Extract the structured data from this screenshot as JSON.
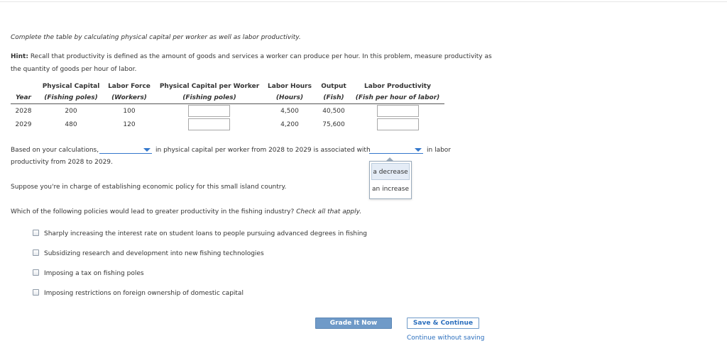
{
  "instruction": "Complete the table by calculating physical capital per worker as well as labor productivity.",
  "hint": {
    "label": "Hint:",
    "line1": "Recall that productivity is defined as the amount of goods and services a worker can produce per hour. In this problem, measure productivity as",
    "line2": "the quantity of goods per hour of labor."
  },
  "table": {
    "headers": [
      {
        "title": "",
        "sub": "Year"
      },
      {
        "title": "Physical Capital",
        "sub": "(Fishing poles)"
      },
      {
        "title": "Labor Force",
        "sub": "(Workers)"
      },
      {
        "title": "Physical Capital per Worker",
        "sub": "(Fishing poles)"
      },
      {
        "title": "Labor Hours",
        "sub": "(Hours)"
      },
      {
        "title": "Output",
        "sub": "(Fish)"
      },
      {
        "title": "Labor Productivity",
        "sub": "(Fish per hour of labor)"
      }
    ],
    "rows": [
      {
        "year": "2028",
        "capital": "200",
        "labor": "100",
        "capital_per_worker": "",
        "hours": "4,500",
        "output": "40,500",
        "productivity": ""
      },
      {
        "year": "2029",
        "capital": "480",
        "labor": "120",
        "capital_per_worker": "",
        "hours": "4,200",
        "output": "75,600",
        "productivity": ""
      }
    ]
  },
  "sentence": {
    "part1": "Based on your calculations,",
    "part2": "in physical capital per worker from 2028 to 2029 is associated with",
    "part3": "in labor",
    "part4": "productivity from 2028 to 2029.",
    "dropdown1_value": "",
    "dropdown2_value": ""
  },
  "dropdown_options": [
    "a decrease",
    "an increase"
  ],
  "scenario": "Suppose you're in charge of establishing economic policy for this small island country.",
  "question": {
    "text": "Which of the following policies would lead to greater productivity in the fishing industry?",
    "emphasis": "Check all that apply."
  },
  "options": [
    "Sharply increasing the interest rate on student loans to people pursuing advanced degrees in fishing",
    "Subsidizing research and development into new fishing technologies",
    "Imposing a tax on fishing poles",
    "Imposing restrictions on foreign ownership of domestic capital"
  ],
  "buttons": {
    "grade": "Grade It Now",
    "save": "Save & Continue",
    "continue_link": "Continue without saving"
  },
  "colors": {
    "accent": "#3377cc",
    "button_blue": "#6f9ac8",
    "link_blue": "#2a6ebd"
  }
}
